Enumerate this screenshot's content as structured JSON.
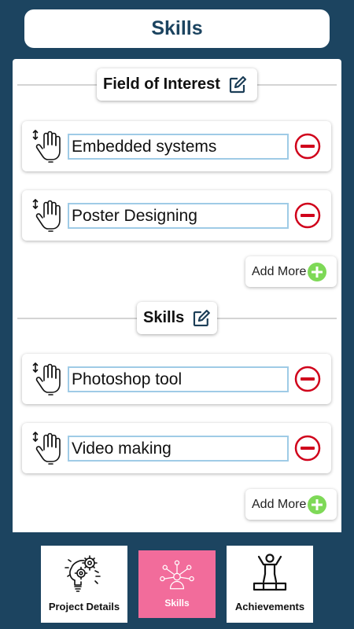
{
  "header": {
    "title": "Skills"
  },
  "sections": [
    {
      "title": "Field of Interest",
      "items": [
        "Embedded systems",
        "Poster Designing"
      ],
      "add_label": "Add More"
    },
    {
      "title": "Skills",
      "items": [
        "Photoshop tool",
        "Video making"
      ],
      "add_label": "Add More"
    }
  ],
  "bottom_nav": [
    {
      "label": "Project Details",
      "icon": "brain-gears-icon",
      "active": false
    },
    {
      "label": "Skills",
      "icon": "person-network-icon",
      "active": true
    },
    {
      "label": "Achievements",
      "icon": "podium-winner-icon",
      "active": false
    }
  ],
  "colors": {
    "background": "#1c4460",
    "remove": "#d0021b",
    "add": "#7ed957",
    "active_tab": "#f26c9b",
    "field_border": "#9fcbe6"
  }
}
